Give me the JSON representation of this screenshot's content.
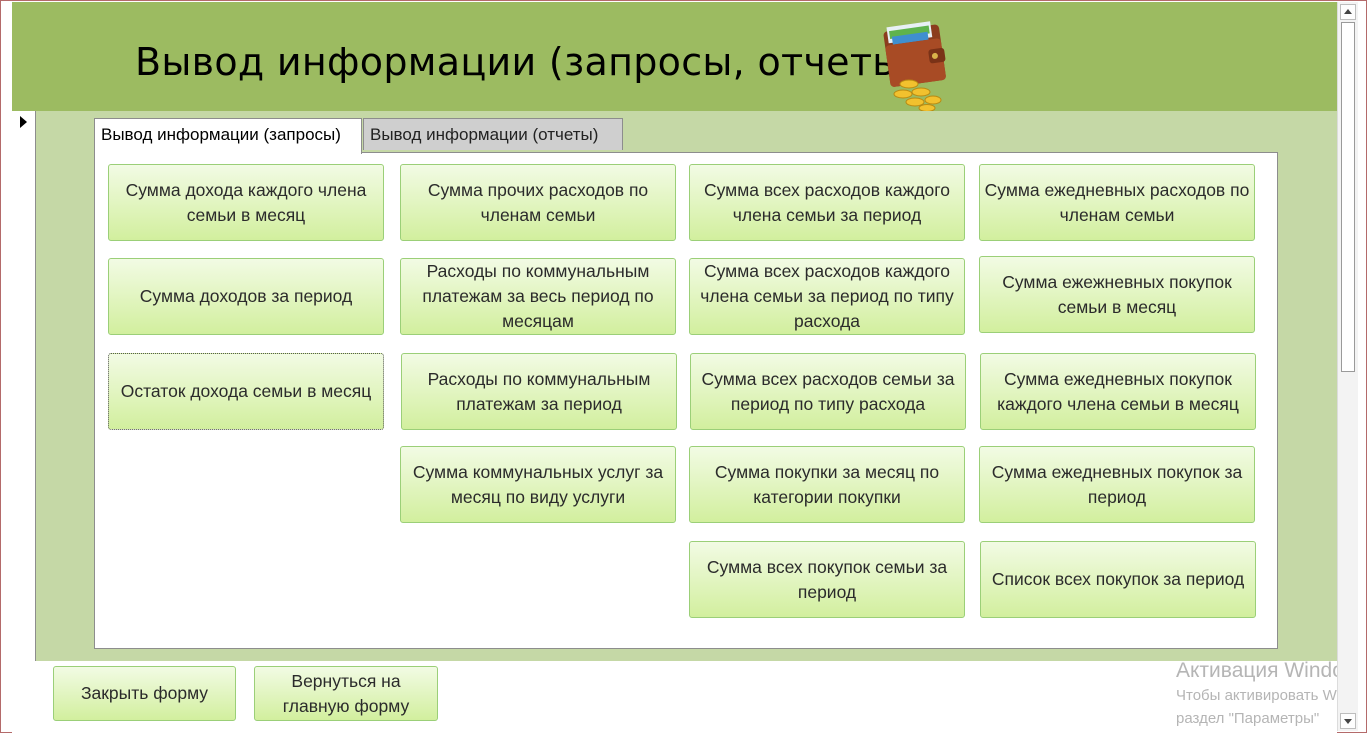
{
  "header": {
    "title": "Вывод информации (запросы, отчеты)"
  },
  "tabs": [
    {
      "label": "Вывод информации (запросы)",
      "active": true
    },
    {
      "label": "Вывод информации (отчеты)",
      "active": false
    }
  ],
  "buttons": {
    "c1": [
      "Сумма дохода каждого члена семьи в месяц",
      "Сумма доходов за период",
      "Остаток дохода семьи в месяц"
    ],
    "c2": [
      "Сумма прочих расходов по членам семьи",
      "Расходы по коммунальным платежам за весь период по месяцам",
      "Расходы по коммунальным платежам за период",
      "Сумма коммунальных услуг за месяц по виду услуги"
    ],
    "c3": [
      "Сумма всех расходов каждого члена семьи за период",
      "Сумма всех расходов каждого члена семьи за период по типу расхода",
      "Сумма всех расходов  семьи за период по типу расхода",
      "Сумма покупки за месяц по категории покупки",
      "Сумма всех покупок семьи за период"
    ],
    "c4": [
      "Сумма ежедневных расходов по членам семьи",
      "Сумма ежежневных покупок семьи в месяц",
      "Сумма ежедневных покупок каждого члена семьи в месяц",
      "Сумма ежедневных покупок за период",
      "Список всех покупок за период"
    ]
  },
  "footer": {
    "close_label": "Закрыть форму",
    "back_label": "Вернуться на главную форму"
  },
  "watermark": {
    "title": "Активация Windo",
    "line1": "Чтобы активировать W",
    "line2": "раздел \"Параметры\""
  },
  "icons": {
    "wallet": "wallet-with-coins-icon",
    "record_selector": "record-selector-arrow-icon"
  },
  "colors": {
    "header_bg": "#9cbb61",
    "detail_bg": "#c5d8a6",
    "button_top": "#f2fbe4",
    "button_bottom": "#d2ef9e",
    "button_border": "#9bcf78"
  }
}
